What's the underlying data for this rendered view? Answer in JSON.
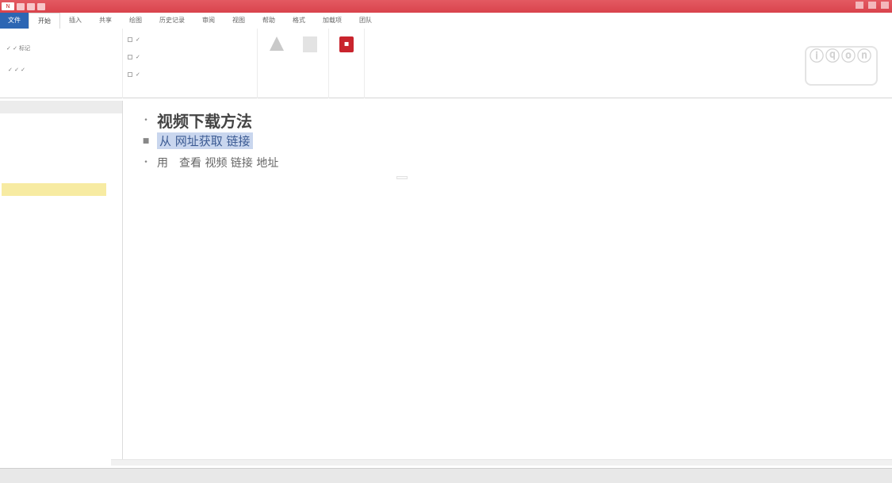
{
  "window": {
    "qat_badge": "N",
    "title": "",
    "accent": "#d9434c",
    "file_blue": "#2d66b3"
  },
  "tabs": [
    "文件",
    "开始",
    "插入",
    "共享",
    "绘图",
    "历史记录",
    "审阅",
    "视图",
    "帮助",
    "格式",
    "加载项",
    "团队"
  ],
  "ribbon": {
    "left_labels": [
      "✓ ✓ 标记",
      "✓ ✓ ✓"
    ],
    "mid_label": "",
    "checks": [
      "✓",
      "✓",
      "✓"
    ],
    "group_labels": [
      "",
      "",
      ""
    ],
    "big_buttons": [
      {
        "label": "",
        "icon": "triangle-icon"
      },
      {
        "label": "",
        "icon": "gray-icon"
      },
      {
        "label": "",
        "icon": "red-icon"
      }
    ],
    "watermark": "ⓘⓠⓞⓝ"
  },
  "leftpane": {
    "header_left": "",
    "header_right": "",
    "search_placeholder": "",
    "filter": "",
    "items": [
      "",
      "",
      ""
    ]
  },
  "doc": {
    "lines": [
      {
        "bullet": "•",
        "text": "视频下载方法"
      },
      {
        "bullet": "■",
        "text": "从 网址获取 链接"
      },
      {
        "bullet": "•",
        "text_pre": "用",
        "link": "",
        "text_post": "查看 视频 链接 地址"
      }
    ],
    "paste_badge": ""
  },
  "taskbar": {
    "items": [
      "",
      "",
      "",
      "",
      ""
    ],
    "tray": ""
  }
}
